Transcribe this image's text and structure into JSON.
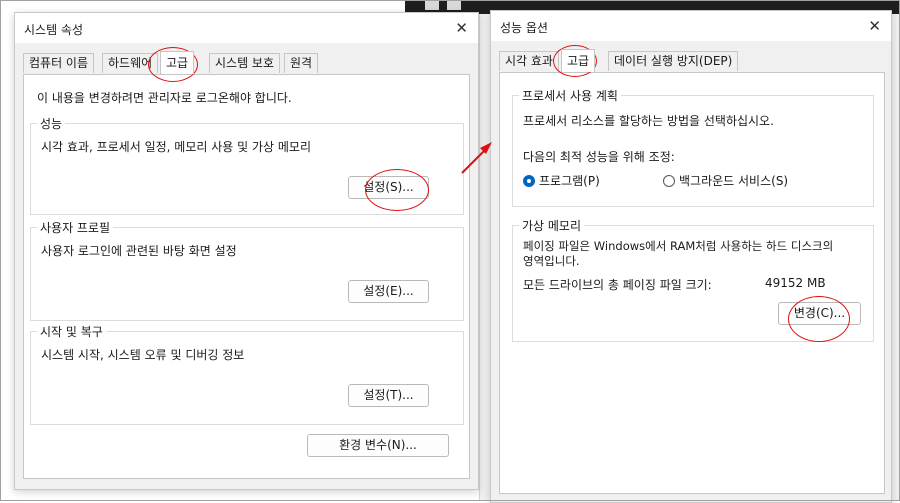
{
  "left_dialog": {
    "title": "시스템 속성",
    "close_icon": "close-icon",
    "tabs": [
      "컴퓨터 이름",
      "하드웨어",
      "고급",
      "시스템 보호",
      "원격"
    ],
    "active_tab": "고급",
    "intro": "이 내용을 변경하려면 관리자로 로그온해야 합니다.",
    "performance": {
      "title": "성능",
      "desc": "시각 효과, 프로세서 일정, 메모리 사용 및 가상 메모리",
      "button": "설정(S)..."
    },
    "user_profile": {
      "title": "사용자 프로필",
      "desc": "사용자 로그인에 관련된 바탕 화면 설정",
      "button": "설정(E)..."
    },
    "startup": {
      "title": "시작 및 복구",
      "desc": "시스템 시작, 시스템 오류 및 디버깅 정보",
      "button": "설정(T)..."
    },
    "env_button": "환경 변수(N)..."
  },
  "right_dialog": {
    "title": "성능 옵션",
    "close_icon": "close-icon",
    "tabs": [
      "시각 효과",
      "고급",
      "데이터 실행 방지(DEP)"
    ],
    "active_tab": "고급",
    "scheduling": {
      "title": "프로세서 사용 계획",
      "desc": "프로세서 리소스를 할당하는 방법을 선택하십시오.",
      "adjust_label": "다음의 최적 성능을 위해 조정:",
      "options": [
        "프로그램(P)",
        "백그라운드 서비스(S)"
      ],
      "selected": "프로그램(P)"
    },
    "virtual_memory": {
      "title": "가상 메모리",
      "desc_line1": "페이징 파일은 Windows에서 RAM처럼 사용하는 하드 디스크의",
      "desc_line2": "영역입니다.",
      "total_label": "모든 드라이브의 총 페이징 파일 크기:",
      "total_value": "49152 MB",
      "button": "변경(C)..."
    }
  },
  "annotation_color": "#e01010"
}
